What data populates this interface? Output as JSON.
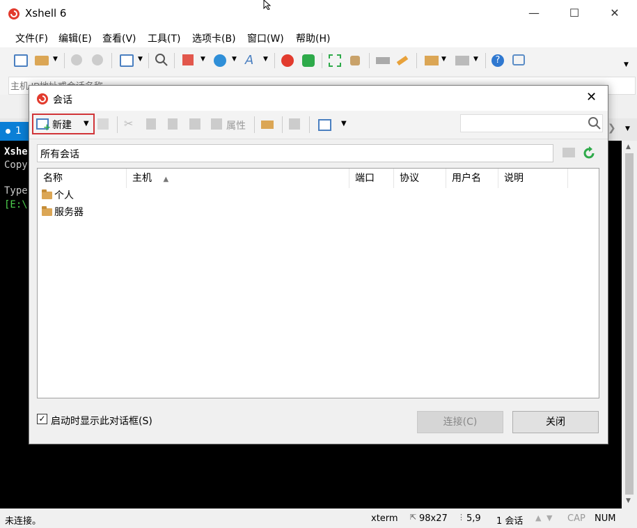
{
  "app": {
    "title": "Xshell 6",
    "menu": [
      "文件(F)",
      "编辑(E)",
      "查看(V)",
      "工具(T)",
      "选项卡(B)",
      "窗口(W)",
      "帮助(H)"
    ],
    "address_placeholder": "主机 IP地址或会话名称",
    "tab_label": "1 "
  },
  "terminal": {
    "lines": [
      "Xshe",
      "Copy",
      "",
      "Type",
      "[E:\\"
    ]
  },
  "status": {
    "left": "未连接。",
    "term": "xterm",
    "size": "98x27",
    "cursor": "5,9",
    "sessions": "1 会话",
    "cap": "CAP",
    "num": "NUM"
  },
  "dialog": {
    "title": "会话",
    "new_label": "新建",
    "properties_label": "属性",
    "path": "所有会话",
    "columns": [
      "名称",
      "主机",
      "端口",
      "协议",
      "用户名",
      "说明"
    ],
    "folders": [
      "个人",
      "服务器"
    ],
    "startup_checkbox_label": "启动时显示此对话框(S)",
    "connect_label": "连接(C)",
    "close_label": "关闭"
  },
  "colors": {
    "accent": "#0b7fd6",
    "highlight_border": "#d13438",
    "folder": "#dba655"
  }
}
